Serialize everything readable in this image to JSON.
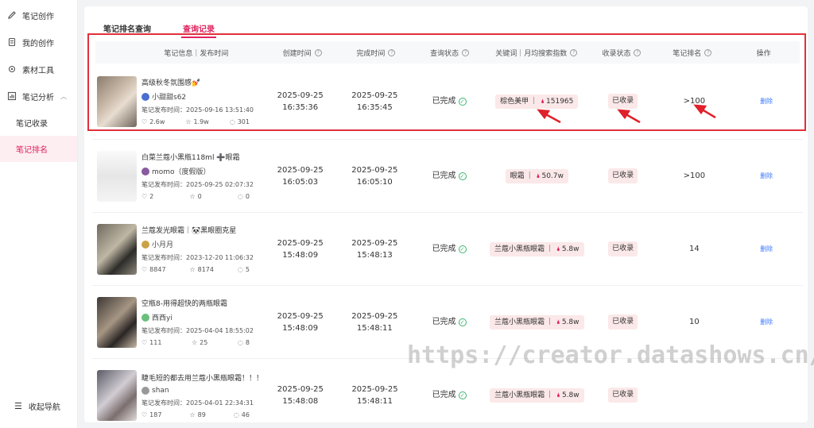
{
  "sidebar": {
    "items": [
      {
        "label": "笔记创作",
        "icon": "pen-icon"
      },
      {
        "label": "我的创作",
        "icon": "document-icon"
      },
      {
        "label": "素材工具",
        "icon": "gear-icon"
      },
      {
        "label": "笔记分析",
        "icon": "chart-icon"
      }
    ],
    "sub_items": [
      {
        "label": "笔记收录"
      },
      {
        "label": "笔记排名"
      }
    ],
    "footer_label": "收起导航"
  },
  "tabs": [
    {
      "label": "笔记排名查询"
    },
    {
      "label": "查询记录"
    }
  ],
  "table": {
    "headers": [
      "笔记信息｜发布时间",
      "创建时间",
      "完成时间",
      "查询状态",
      "关键词｜月均搜索指数",
      "收录状态",
      "笔记排名",
      "操作"
    ],
    "rows": [
      {
        "title": "高级秋冬氛围感💅",
        "author": "小甜甜s62",
        "pub": "笔记发布时间：2025-09-16 13:51:40",
        "likes": "2.6w",
        "stars": "1.9w",
        "comments": "301",
        "created_date": "2025-09-25",
        "created_time": "16:35:36",
        "finished_date": "2025-09-25",
        "finished_time": "16:35:45",
        "status": "已完成",
        "keyword": "棕色美甲",
        "index": "151965",
        "index_status": "已收录",
        "rank": ">100",
        "action": "删除"
      },
      {
        "title": "白菜兰蔻小黑瓶118ml ➕眼霜",
        "author": "momo（度假版）",
        "pub": "笔记发布时间：2025-09-25 02:07:32",
        "likes": "2",
        "stars": "0",
        "comments": "0",
        "created_date": "2025-09-25",
        "created_time": "16:05:03",
        "finished_date": "2025-09-25",
        "finished_time": "16:05:10",
        "status": "已完成",
        "keyword": "眼霜",
        "index": "50.7w",
        "index_status": "已收录",
        "rank": ">100",
        "action": "删除"
      },
      {
        "title": "兰蔻发光眼霜｜🐼黑眼圈克星",
        "author": "小月月",
        "pub": "笔记发布时间：2023-12-20 11:06:32",
        "likes": "8847",
        "stars": "8174",
        "comments": "5",
        "created_date": "2025-09-25",
        "created_time": "15:48:09",
        "finished_date": "2025-09-25",
        "finished_time": "15:48:13",
        "status": "已完成",
        "keyword": "兰蔻小黑瓶眼霜",
        "index": "5.8w",
        "index_status": "已收录",
        "rank": "14",
        "action": "删除"
      },
      {
        "title": "空瓶8-用得超快的两瓶眼霜",
        "author": "西西yi",
        "pub": "笔记发布时间：2025-04-04 18:55:02",
        "likes": "111",
        "stars": "25",
        "comments": "8",
        "created_date": "2025-09-25",
        "created_time": "15:48:09",
        "finished_date": "2025-09-25",
        "finished_time": "15:48:11",
        "status": "已完成",
        "keyword": "兰蔻小黑瓶眼霜",
        "index": "5.8w",
        "index_status": "已收录",
        "rank": "10",
        "action": "删除"
      },
      {
        "title": "睫毛短的都去用兰蔻小黑瓶眼霜！！！",
        "author": "shan",
        "pub": "笔记发布时间：2025-04-01 22:34:31",
        "likes": "187",
        "stars": "89",
        "comments": "46",
        "created_date": "2025-09-25",
        "created_time": "15:48:08",
        "finished_date": "2025-09-25",
        "finished_time": "15:48:11",
        "status": "已完成",
        "keyword": "兰蔻小黑瓶眼霜",
        "index": "5.8w",
        "index_status": "已收录",
        "rank": "",
        "action": ""
      }
    ]
  },
  "watermark": "https://creator.datashows.cn/",
  "colors": {
    "accent": "#e0245e",
    "highlight": "#e0303a",
    "link": "#3b7bff",
    "success": "#3ab56e",
    "tag_bg": "#fbe8e8"
  }
}
